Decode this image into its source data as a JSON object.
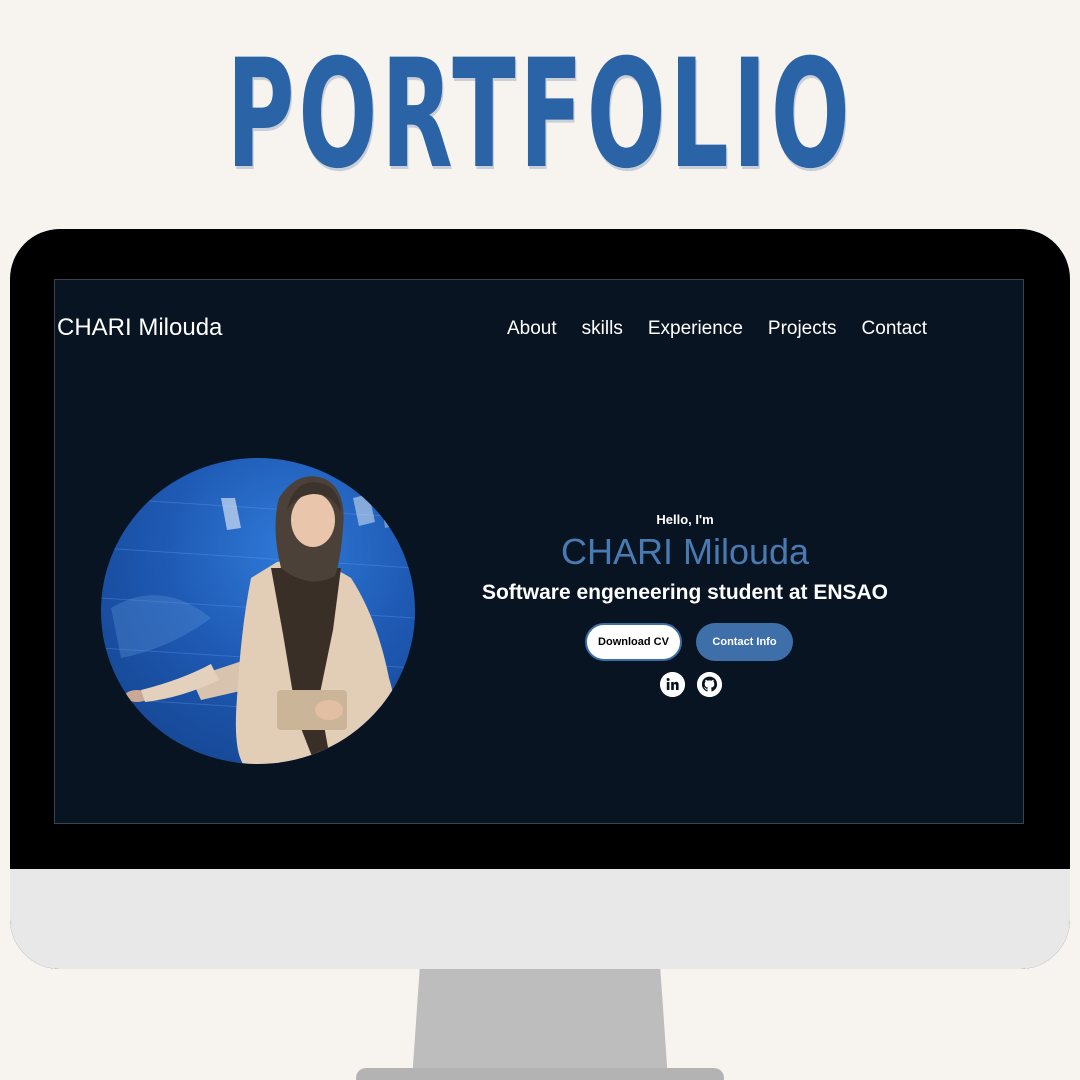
{
  "headline": "PORTFOLIO",
  "site": {
    "brand": "CHARI Milouda",
    "nav": [
      "About",
      "skills",
      "Experience",
      "Projects",
      "Contact"
    ]
  },
  "hero": {
    "greeting": "Hello, I'm",
    "name": "CHARI Milouda",
    "subtitle": "Software engeneering student at ENSAO",
    "buttons": {
      "cv": "Download CV",
      "contact": "Contact Info"
    },
    "icons": [
      "linkedin-icon",
      "github-icon"
    ]
  },
  "colors": {
    "background": "#f7f4ef",
    "headline": "#2b64a6",
    "screen": "#081422",
    "accent": "#4a7ab2",
    "button": "#3e6fa8"
  }
}
